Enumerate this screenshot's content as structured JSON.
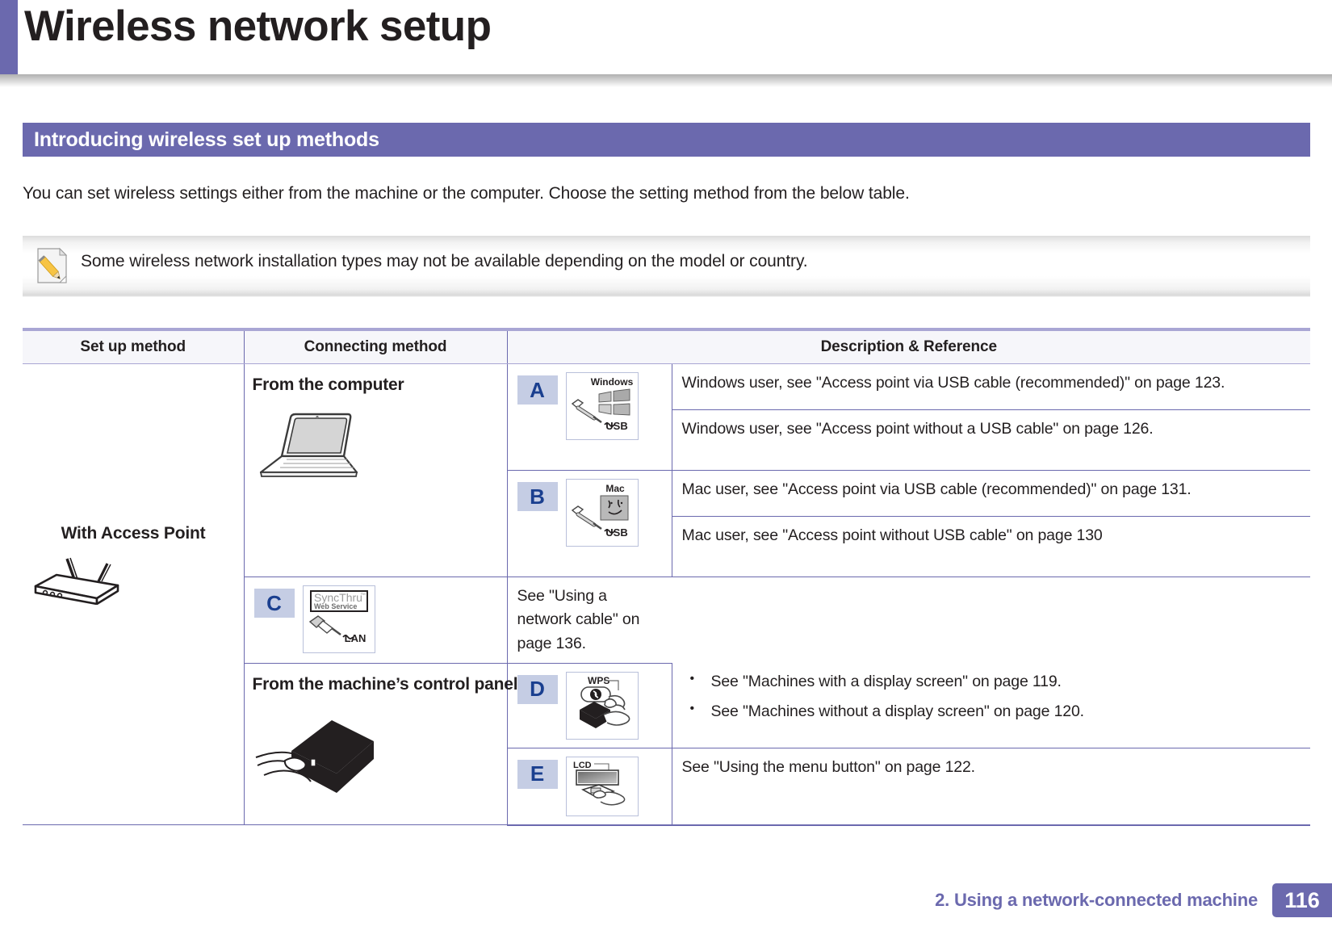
{
  "page": {
    "title": "Wireless network setup",
    "section_heading": "Introducing wireless set up methods",
    "intro_paragraph": "You can set wireless settings either from the machine or the computer. Choose the setting method from the below table.",
    "note": "Some wireless network installation types may not be available depending on the model or country.",
    "accent_color": "#6b69ae",
    "letter_chip_bg": "#c5cde4",
    "letter_chip_color": "#1a3f8f"
  },
  "table": {
    "headers": {
      "setup_method": "Set up method",
      "connecting_method": "Connecting method",
      "description_reference": "Description & Reference"
    },
    "setup_method": {
      "label": "With Access Point",
      "icon": "wireless-router-icon"
    },
    "groups": [
      {
        "connecting_method": "From the computer",
        "icon": "laptop-icon",
        "entries": [
          {
            "letter": "A",
            "thumb_icon": "windows-usb-icon",
            "thumb_labels": {
              "top": "Windows",
              "bottom": "USB"
            },
            "descriptions": [
              {
                "text": "Windows user, see \"Access point via USB cable (recommended)\" on page 123."
              },
              {
                "text": "Windows user, see \"Access point without a USB cable\" on page 126."
              }
            ]
          },
          {
            "letter": "B",
            "thumb_icon": "mac-usb-icon",
            "thumb_labels": {
              "top": "Mac",
              "bottom": "USB"
            },
            "descriptions": [
              {
                "text": "Mac user, see \"Access point via USB cable (recommended)\" on page 131."
              },
              {
                "text": "Mac user, see \"Access point without USB cable\" on page 130"
              }
            ]
          },
          {
            "letter": "C",
            "thumb_icon": "syncthru-lan-icon",
            "thumb_labels": {
              "top": "SyncThru™",
              "sub": "Web Service",
              "bottom": "LAN"
            },
            "descriptions": [
              {
                "text": "See \"Using a network cable\" on page 136."
              }
            ]
          }
        ]
      },
      {
        "connecting_method": "From the machine’s control panel",
        "icon": "printer-hand-icon",
        "entries": [
          {
            "letter": "D",
            "thumb_icon": "wps-button-icon",
            "thumb_labels": {
              "top": "WPS"
            },
            "bullets": [
              "See \"Machines with a display screen\" on page 119.",
              "See \"Machines without a display screen\" on page 120."
            ]
          },
          {
            "letter": "E",
            "thumb_icon": "lcd-panel-icon",
            "thumb_labels": {
              "top": "LCD"
            },
            "descriptions": [
              {
                "text": "See \"Using the menu button\" on page 122."
              }
            ]
          }
        ]
      }
    ]
  },
  "footer": {
    "chapter": "2.  Using a network-connected machine",
    "page_number": "116"
  }
}
